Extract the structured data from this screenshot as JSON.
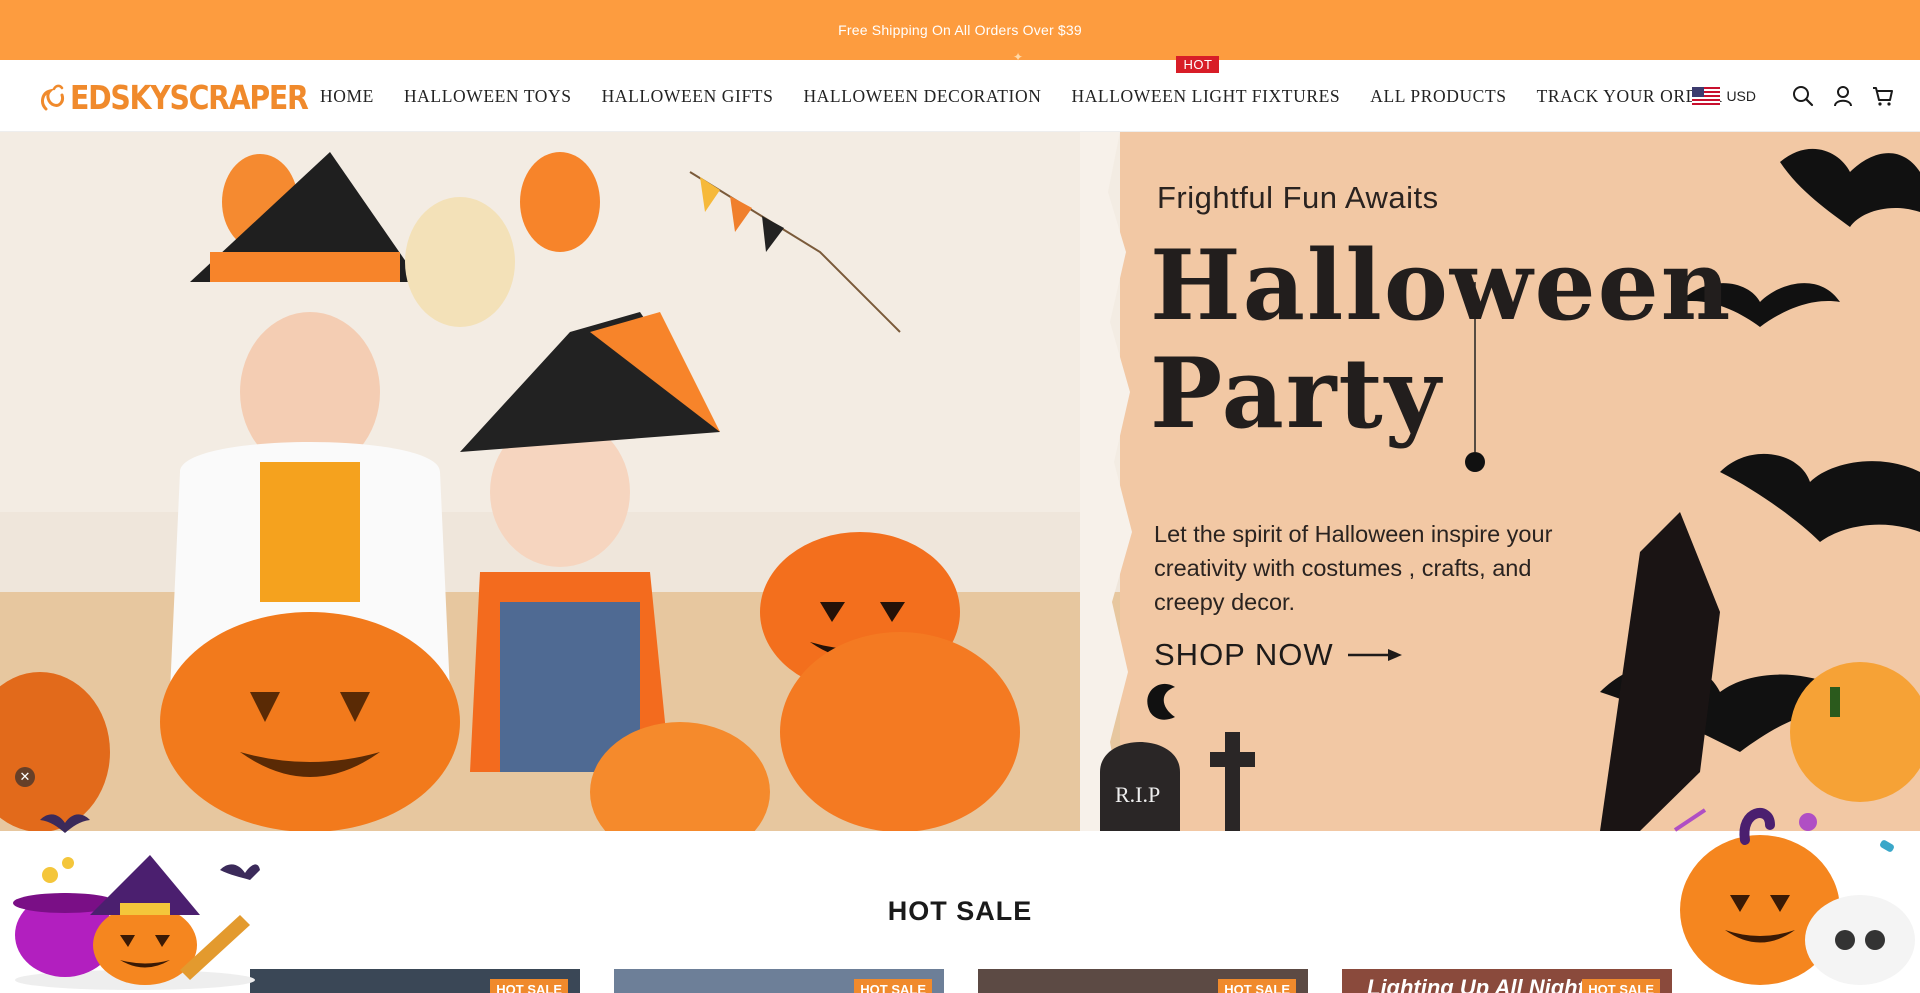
{
  "announcement": {
    "text": "Free Shipping On All Orders Over $39"
  },
  "header": {
    "logo_text": "EDSKYSCRAPER",
    "nav": [
      {
        "label": "HOME"
      },
      {
        "label": "HALLOWEEN TOYS"
      },
      {
        "label": "HALLOWEEN GIFTS"
      },
      {
        "label": "HALLOWEEN DECORATION"
      },
      {
        "label": "HALLOWEEN LIGHT FIXTURES",
        "badge": "HOT"
      },
      {
        "label": "ALL PRODUCTS"
      },
      {
        "label": "TRACK YOUR ORDER"
      }
    ],
    "currency": "USD",
    "icons": [
      "search-icon",
      "account-icon",
      "cart-icon"
    ]
  },
  "hero": {
    "kicker": "Frightful Fun Awaits",
    "title_line1": "Halloween",
    "title_line2": "Party",
    "description": "Let the spirit of Halloween inspire your creativity with costumes , crafts, and creepy decor.",
    "cta": "SHOP NOW",
    "photo_text": "R.I.P"
  },
  "hot_sale": {
    "title": "HOT SALE",
    "cards": [
      {
        "badge": "HOT SALE",
        "caption": ""
      },
      {
        "badge": "HOT SALE",
        "caption": ""
      },
      {
        "badge": "HOT SALE",
        "caption": ""
      },
      {
        "badge": "HOT SALE",
        "caption": "Lighting Up All Night f"
      }
    ]
  },
  "colors": {
    "announcement_bg": "#fd9c3f",
    "brand_orange": "#f08a2c",
    "hot_badge": "#d81d27",
    "hero_bg": "#f2c8a4"
  }
}
